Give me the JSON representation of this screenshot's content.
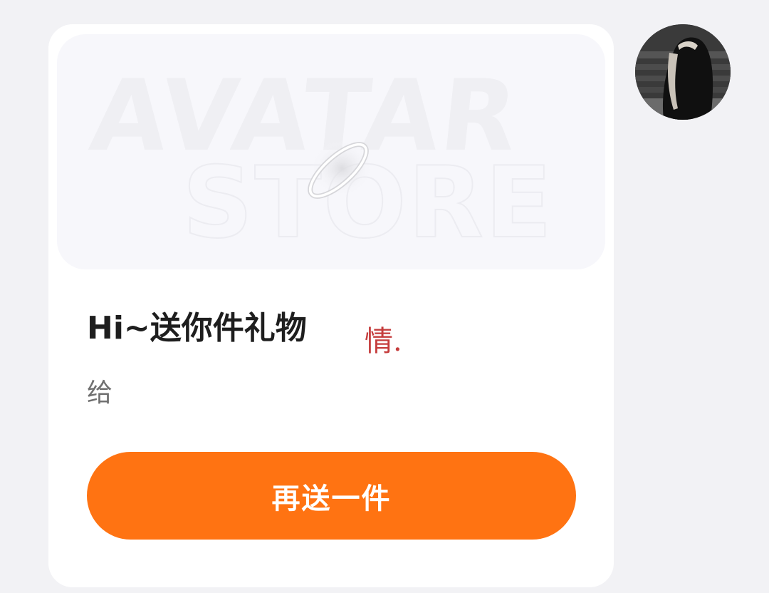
{
  "banner": {
    "watermark_line1": "AVATAR",
    "watermark_line2": "STORE",
    "icon": "halo-ring-icon"
  },
  "gift": {
    "title": "Hi~送你件礼物",
    "stamp": "情.",
    "subtitle": "给"
  },
  "actions": {
    "send_again_label": "再送一件"
  },
  "avatar": {
    "icon": "user-avatar"
  },
  "colors": {
    "background": "#f2f2f5",
    "accent": "#ff7312",
    "stamp": "#c53c3c"
  }
}
